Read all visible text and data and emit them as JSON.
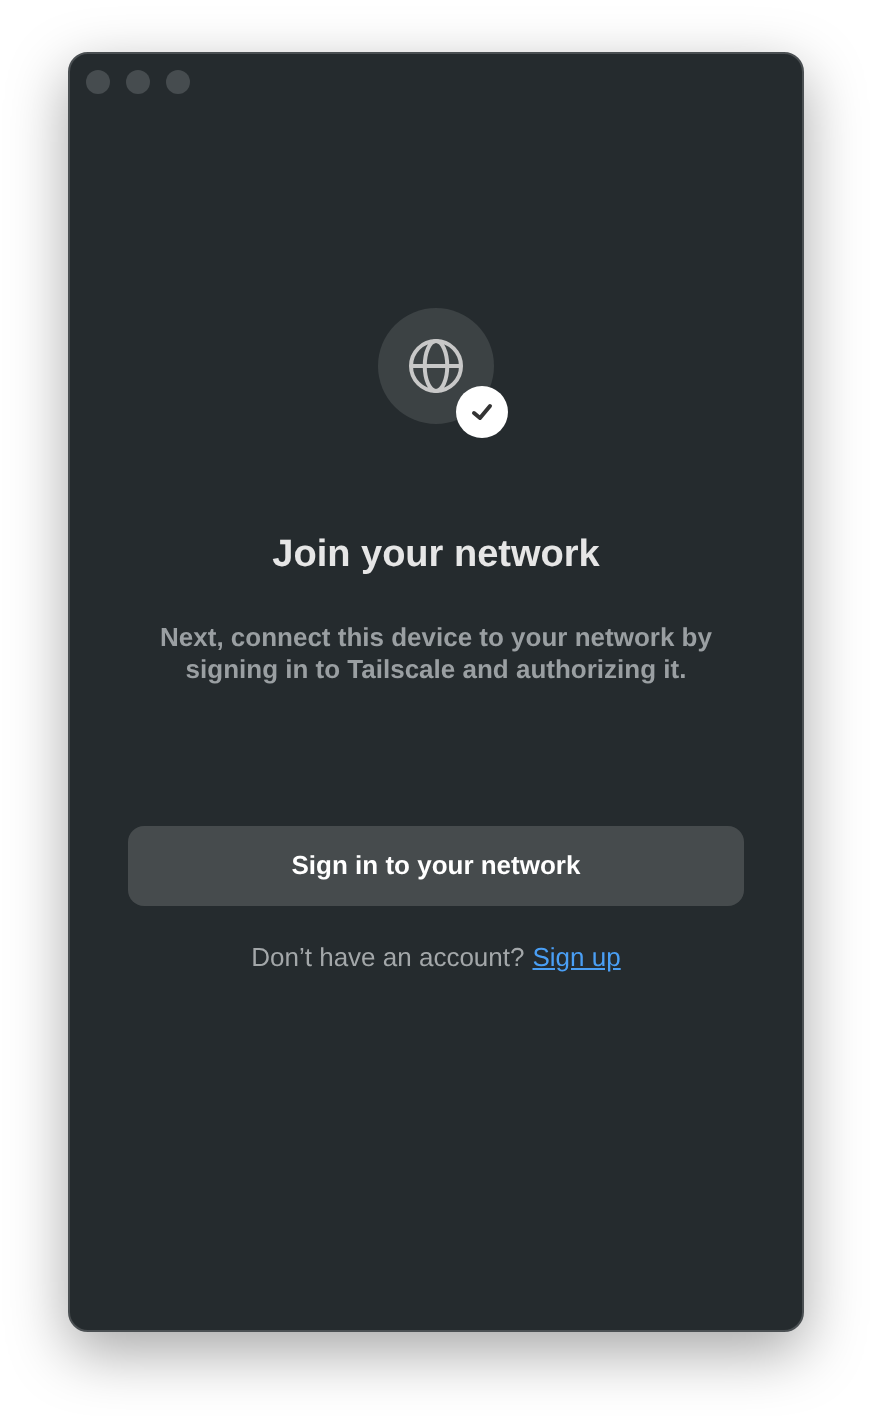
{
  "title": "Join your network",
  "description": "Next, connect this device to your network by signing in to Tailscale and authorizing it.",
  "sign_in_button": "Sign in to your network",
  "footer": {
    "prompt": "Don’t have an account?",
    "link": "Sign up"
  }
}
